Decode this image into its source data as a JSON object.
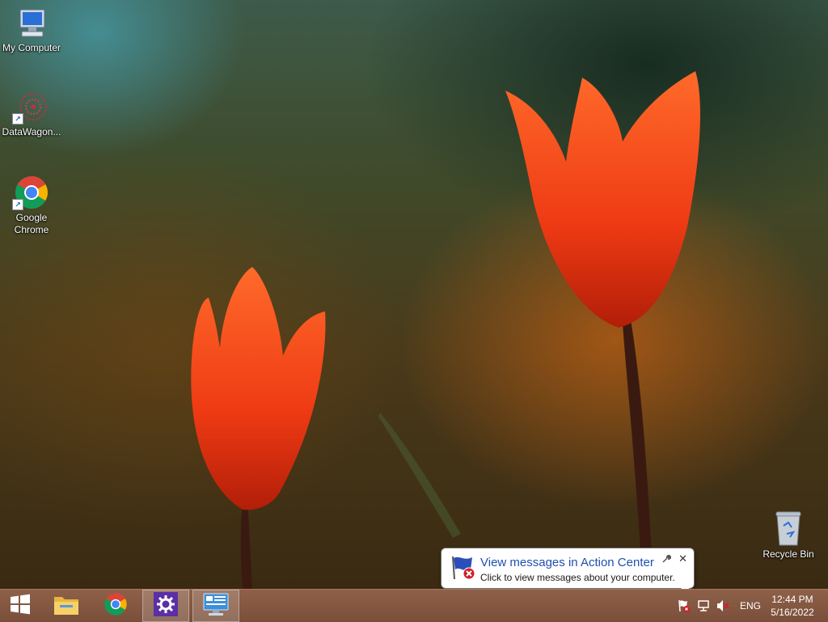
{
  "desktop": {
    "icons": [
      {
        "label": "My Computer"
      },
      {
        "label": "DataWagon..."
      },
      {
        "label": "Google Chrome"
      },
      {
        "label": "Recycle Bin"
      }
    ]
  },
  "notification": {
    "title": "View messages in Action Center",
    "message": "Click to view messages about your computer."
  },
  "taskbar": {
    "start_icon": "windows-logo-icon",
    "pinned": [
      {
        "name": "File Explorer",
        "icon": "folder-icon"
      },
      {
        "name": "Google Chrome",
        "icon": "chrome-icon"
      },
      {
        "name": "Settings",
        "icon": "gear-icon"
      },
      {
        "name": "Control Panel",
        "icon": "control-panel-icon"
      }
    ],
    "tray": {
      "language": "ENG",
      "time": "12:44 PM",
      "date": "5/16/2022"
    }
  },
  "colors": {
    "taskbar": "#7a4f3a",
    "notification_title": "#1f4fb0",
    "settings_tile": "#5b2fa6",
    "error_red": "#d0202a"
  }
}
